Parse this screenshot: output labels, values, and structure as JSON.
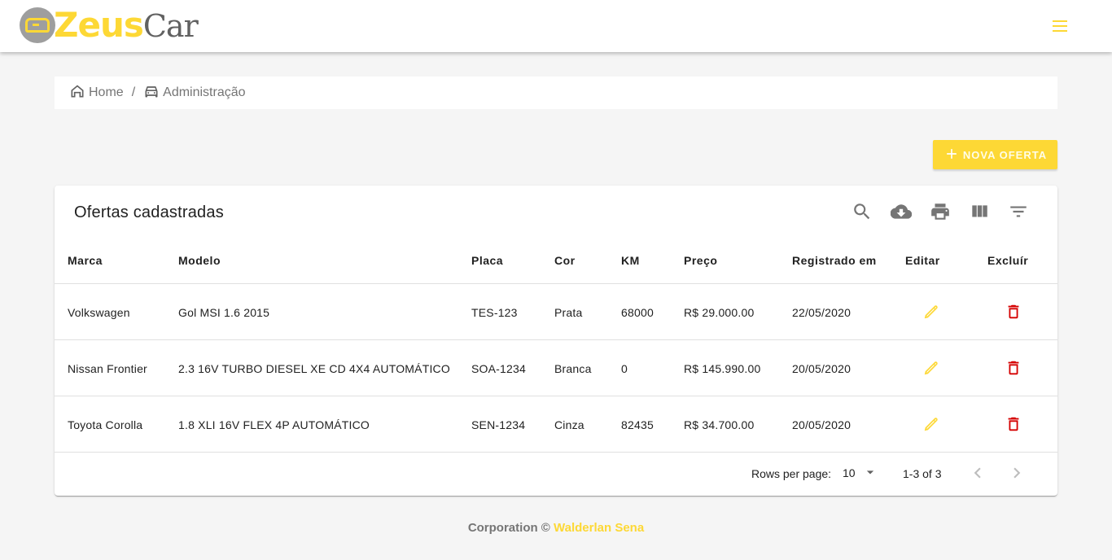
{
  "brand": {
    "name_part1": "Zeus",
    "name_part2": "Car",
    "accent_color": "#fdd835"
  },
  "header": {
    "menu_icon": "menu-icon"
  },
  "breadcrumb": [
    {
      "label": "Home",
      "icon": "home-icon"
    },
    {
      "label": "Administração",
      "icon": "car-icon"
    }
  ],
  "breadcrumb_separator": "/",
  "actions": {
    "new_offer_label": "Nova oferta",
    "new_offer_icon": "plus-icon"
  },
  "table": {
    "title": "Ofertas cadastradas",
    "toolbar_icons": [
      "search-icon",
      "download-icon",
      "print-icon",
      "view-columns-icon",
      "filter-icon"
    ],
    "columns": [
      "Marca",
      "Modelo",
      "Placa",
      "Cor",
      "KM",
      "Preço",
      "Registrado em",
      "Editar",
      "Excluír"
    ],
    "rows": [
      {
        "marca": "Volkswagen",
        "modelo": "Gol MSI 1.6 2015",
        "placa": "TES-123",
        "cor": "Prata",
        "km": "68000",
        "preco": "R$ 29.000.00",
        "registrado": "22/05/2020"
      },
      {
        "marca": "Nissan Frontier",
        "modelo": "2.3 16V TURBO DIESEL XE CD 4X4 AUTOMÁTICO",
        "placa": "SOA-1234",
        "cor": "Branca",
        "km": "0",
        "preco": "R$ 145.990.00",
        "registrado": "20/05/2020"
      },
      {
        "marca": "Toyota Corolla",
        "modelo": "1.8 XLI 16V FLEX 4P AUTOMÁTICO",
        "placa": "SEN-1234",
        "cor": "Cinza",
        "km": "82435",
        "preco": "R$ 34.700.00",
        "registrado": "20/05/2020"
      }
    ],
    "edit_icon": "pencil-icon",
    "delete_icon": "trash-icon",
    "edit_color": "#fdd835",
    "delete_color": "#d50000"
  },
  "pagination": {
    "rows_per_page_label": "Rows per page:",
    "rows_per_page_value": "10",
    "range_label": "1-3 of 3"
  },
  "footer": {
    "text": "Corporation ©",
    "author": "Walderlan Sena"
  }
}
